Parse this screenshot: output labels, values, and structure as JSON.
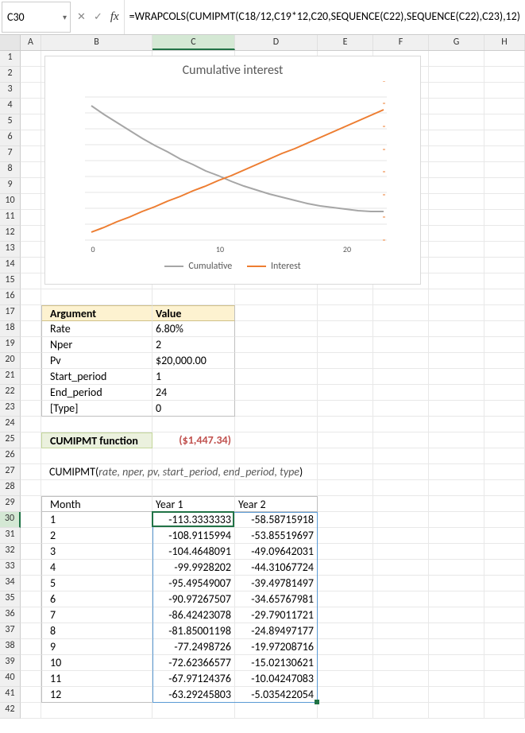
{
  "formula_bar": {
    "cell_ref": "C30",
    "formula": "=WRAPCOLS(CUMIPMT(C18/12,C19*12,C20,SEQUENCE(C22),SEQUENCE(C22),C23),12)"
  },
  "columns": [
    "A",
    "B",
    "C",
    "D",
    "E",
    "F",
    "G",
    "H"
  ],
  "rows": [
    "1",
    "2",
    "3",
    "4",
    "5",
    "6",
    "7",
    "8",
    "9",
    "10",
    "11",
    "12",
    "13",
    "14",
    "15",
    "16",
    "17",
    "18",
    "19",
    "20",
    "21",
    "22",
    "23",
    "24",
    "25",
    "26",
    "27",
    "28",
    "29",
    "30",
    "31",
    "32",
    "33",
    "34",
    "35",
    "36",
    "37",
    "38",
    "39",
    "40",
    "41",
    "42"
  ],
  "active_cell": "C30",
  "chart": {
    "title": "Cumulative interest",
    "legend": {
      "cumulative": "Cumulative",
      "interest": "Interest"
    }
  },
  "args_table": {
    "header_arg": "Argument",
    "header_val": "Value",
    "rows": [
      {
        "arg": "Rate",
        "val": "6.80%"
      },
      {
        "arg": "Nper",
        "val": "2"
      },
      {
        "arg": "Pv",
        "val": "$20,000.00"
      },
      {
        "arg": "Start_period",
        "val": "1"
      },
      {
        "arg": "End_period",
        "val": "24"
      },
      {
        "arg": "[Type]",
        "val": "0"
      }
    ]
  },
  "cumipmt": {
    "label": "CUMIPMT function",
    "value": "($1,447.34)",
    "syntax_fn": "CUMIPMT(",
    "syntax_args": "rate, nper, pv, start_period, end_period, type",
    "syntax_close": ")"
  },
  "data_table": {
    "hdr_month": "Month",
    "hdr_y1": "Year 1",
    "hdr_y2": "Year 2",
    "rows": [
      {
        "m": "1",
        "y1": "-113.3333333",
        "y2": "-58.58715918"
      },
      {
        "m": "2",
        "y1": "-108.9115994",
        "y2": "-53.85519697"
      },
      {
        "m": "3",
        "y1": "-104.4648091",
        "y2": "-49.09642031"
      },
      {
        "m": "4",
        "y1": "-99.9928202",
        "y2": "-44.31067724"
      },
      {
        "m": "5",
        "y1": "-95.49549007",
        "y2": "-39.49781497"
      },
      {
        "m": "6",
        "y1": "-90.97267507",
        "y2": "-34.65767981"
      },
      {
        "m": "7",
        "y1": "-86.42423078",
        "y2": "-29.79011721"
      },
      {
        "m": "8",
        "y1": "-81.85001198",
        "y2": "-24.89497177"
      },
      {
        "m": "9",
        "y1": "-77.2498726",
        "y2": "-19.97208716"
      },
      {
        "m": "10",
        "y1": "-72.62366577",
        "y2": "-15.02130621"
      },
      {
        "m": "11",
        "y1": "-67.97124376",
        "y2": "-10.04247083"
      },
      {
        "m": "12",
        "y1": "-63.29245803",
        "y2": "-5.035422054"
      }
    ]
  },
  "chart_data": {
    "type": "line",
    "title": "Cumulative interest",
    "x": {
      "min": 1,
      "max": 24,
      "ticks": [
        0,
        10,
        20
      ]
    },
    "y_left": {
      "label": "",
      "min": -1800,
      "max": 200,
      "ticks": [
        200,
        0,
        -200,
        -400,
        -600,
        -800,
        -1000,
        -1200,
        -1400,
        -1600,
        -1800
      ]
    },
    "y_right": {
      "label": "",
      "min": -120,
      "max": 20,
      "ticks": [
        20,
        0,
        -20,
        -40,
        -60,
        -80,
        -100,
        -120
      ]
    },
    "series": [
      {
        "name": "Cumulative",
        "axis": "left",
        "color": "#a6a6a6",
        "values": [
          -113.33,
          -222.24,
          -326.71,
          -426.7,
          -522.2,
          -613.17,
          -699.59,
          -781.44,
          -858.69,
          -931.32,
          -999.29,
          -1062.58,
          -1121.17,
          -1175.02,
          -1224.12,
          -1268.43,
          -1307.93,
          -1342.58,
          -1372.37,
          -1397.27,
          -1417.24,
          -1432.26,
          -1442.31,
          -1447.34
        ]
      },
      {
        "name": "Interest",
        "axis": "right",
        "color": "#ed7d31",
        "values": [
          -113.33,
          -108.91,
          -104.46,
          -99.99,
          -95.5,
          -90.97,
          -86.42,
          -81.85,
          -77.25,
          -72.62,
          -67.97,
          -63.29,
          -58.59,
          -53.86,
          -49.1,
          -44.31,
          -39.5,
          -34.66,
          -29.79,
          -24.89,
          -19.97,
          -15.02,
          -10.04,
          -5.04
        ]
      }
    ]
  }
}
